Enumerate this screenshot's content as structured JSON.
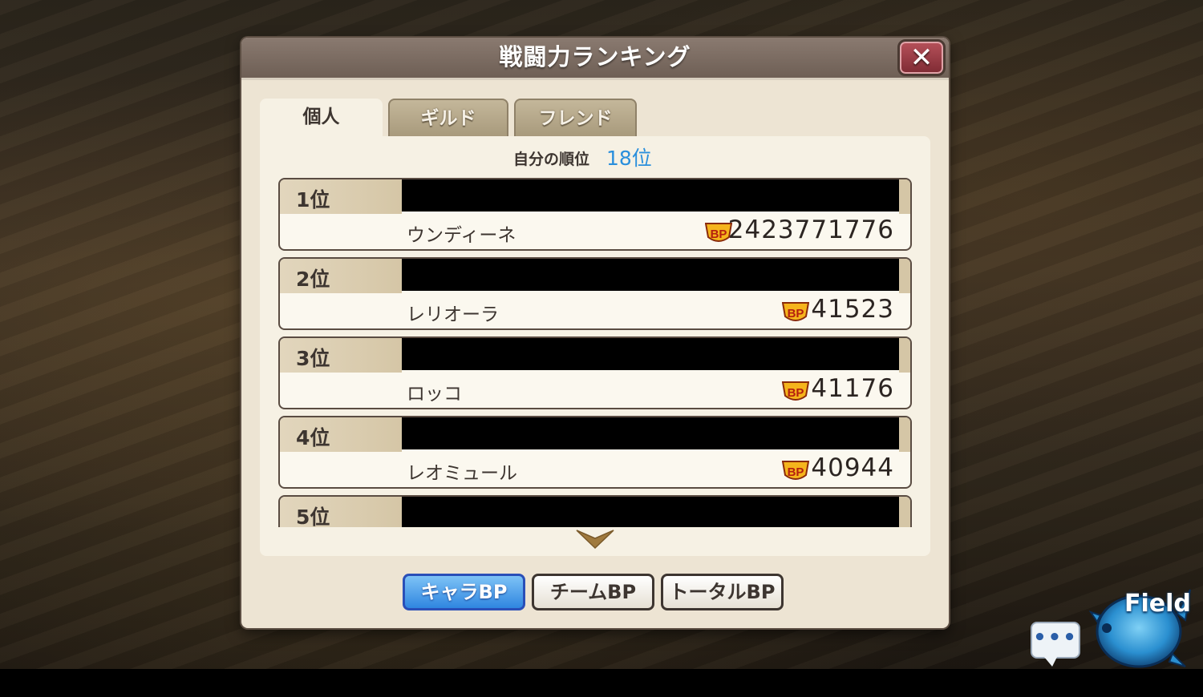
{
  "dialog": {
    "title": "戦闘力ランキング",
    "close_label": "✕"
  },
  "tabs": [
    {
      "label": "個人",
      "active": true
    },
    {
      "label": "ギルド",
      "active": false
    },
    {
      "label": "フレンド",
      "active": false
    }
  ],
  "my_rank": {
    "label": "自分の順位",
    "value": "18位"
  },
  "ranking": [
    {
      "rank": "1位",
      "name": "ウンディーネ",
      "bp": "2423771776"
    },
    {
      "rank": "2位",
      "name": "レリオーラ",
      "bp": "41523"
    },
    {
      "rank": "3位",
      "name": "ロッコ",
      "bp": "41176"
    },
    {
      "rank": "4位",
      "name": "レオミュール",
      "bp": "40944"
    },
    {
      "rank": "5位",
      "name": "",
      "bp": ""
    }
  ],
  "bp_icon_text": "BP",
  "sort_buttons": [
    {
      "label": "キャラBP",
      "active": true
    },
    {
      "label": "チームBP",
      "active": false
    },
    {
      "label": "トータルBP",
      "active": false
    }
  ],
  "hud": {
    "chat_dots": "•••",
    "field_label": "Field"
  },
  "colors": {
    "accent_blue": "#2a8fdc",
    "title_bar": "#7a6b61",
    "panel_bg": "#f6f1e4"
  }
}
